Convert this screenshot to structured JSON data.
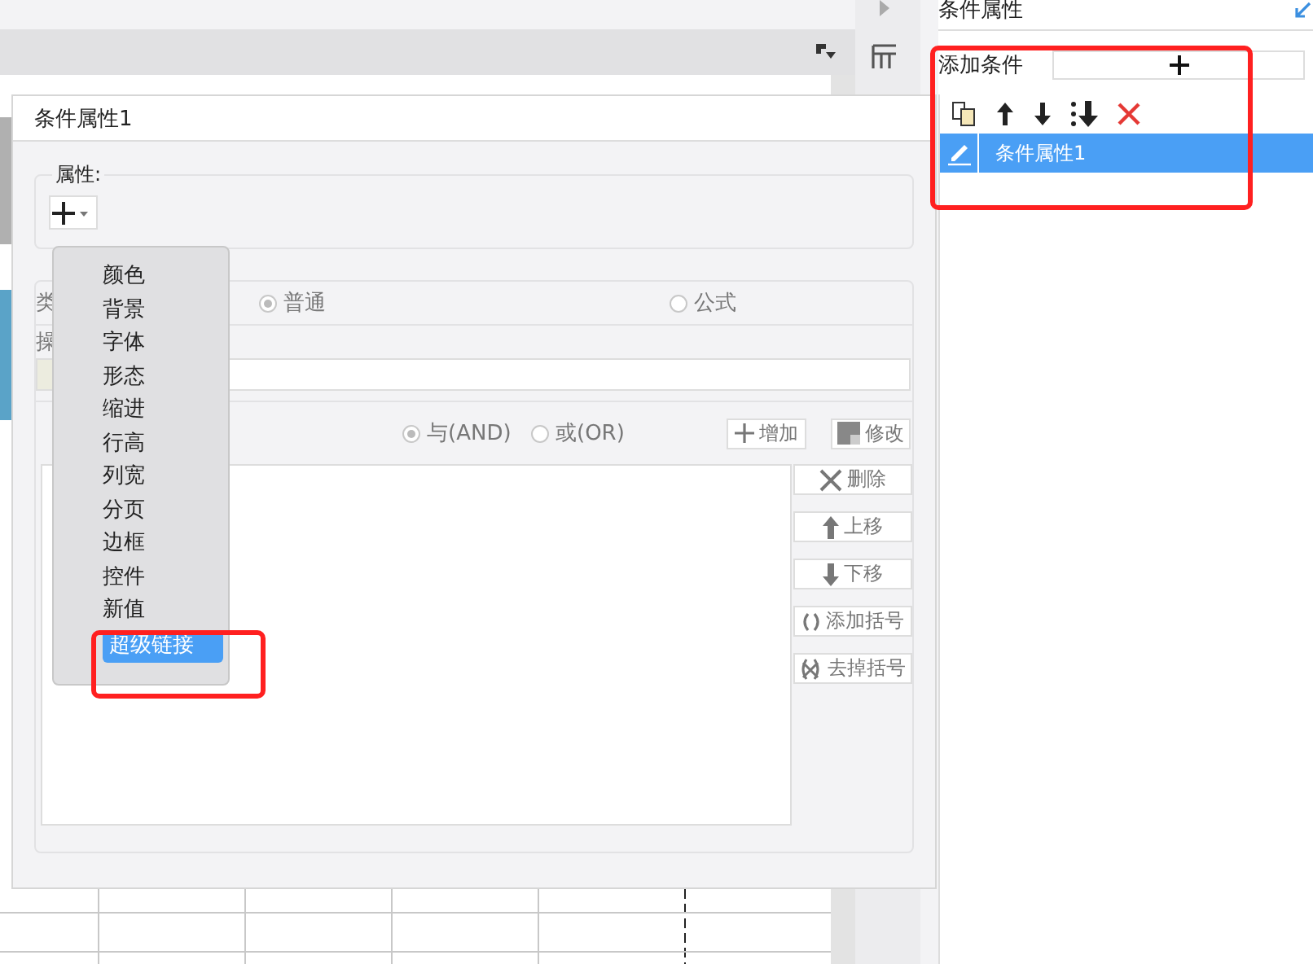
{
  "dialog": {
    "title": "条件属性1",
    "attributes_legend": "属性:",
    "menu": [
      {
        "label": "颜色",
        "selected": false
      },
      {
        "label": "背景",
        "selected": false
      },
      {
        "label": "字体",
        "selected": false
      },
      {
        "label": "形态",
        "selected": false
      },
      {
        "label": "缩进",
        "selected": false
      },
      {
        "label": "行高",
        "selected": false
      },
      {
        "label": "列宽",
        "selected": false
      },
      {
        "label": "分页",
        "selected": false
      },
      {
        "label": "边框",
        "selected": false
      },
      {
        "label": "控件",
        "selected": false
      },
      {
        "label": "新值",
        "selected": false
      },
      {
        "label": "超级链接",
        "selected": true
      }
    ],
    "condition": {
      "type_label": "类",
      "type_options": [
        {
          "label": "普通",
          "selected": true
        },
        {
          "label": "公式",
          "selected": false
        }
      ],
      "operator_label": "操",
      "logic_options": [
        {
          "label": "与(AND)",
          "selected": true
        },
        {
          "label": "或(OR)",
          "selected": false
        }
      ],
      "buttons": [
        "增加",
        "修改"
      ],
      "side_buttons": [
        "删除",
        "上移",
        "下移",
        "添加括号",
        "去掉括号"
      ]
    }
  },
  "panel": {
    "title": "条件属性",
    "add_label": "添加条件",
    "conditions": [
      {
        "label": "条件属性1",
        "selected": true
      }
    ]
  }
}
